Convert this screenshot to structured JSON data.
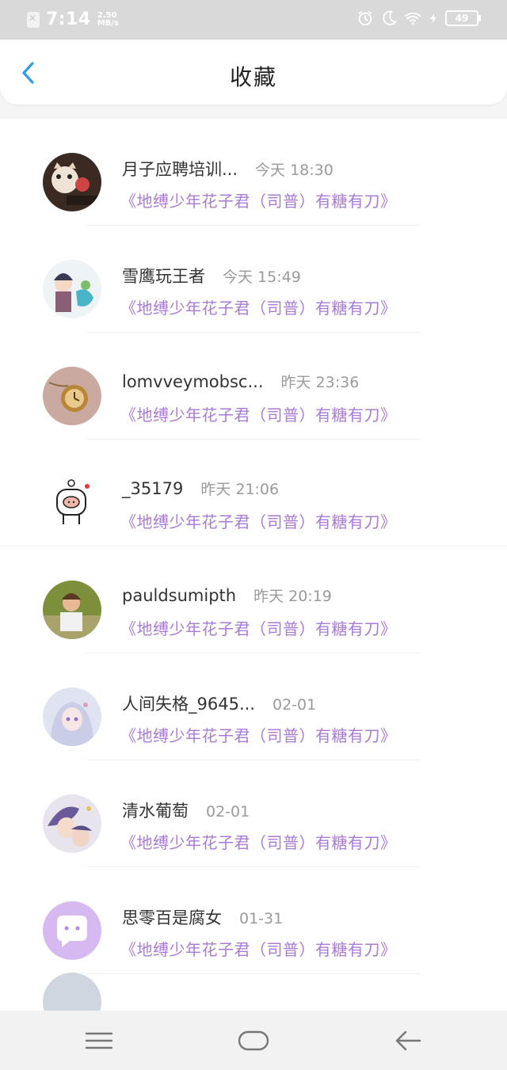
{
  "status_bar": {
    "time": "7:14",
    "speed_value": "2.50",
    "speed_unit": "MB/s",
    "battery": "49",
    "icons": [
      "notification-blocked-icon",
      "alarm-icon",
      "moon-icon",
      "wifi-icon",
      "charging-icon",
      "battery-icon"
    ]
  },
  "header": {
    "title": "收藏",
    "back_icon": "chevron-left-icon"
  },
  "items": [
    {
      "name": "月子应聘培训...",
      "time": "今天 18:30",
      "quote": "《地缚少年花子君（司普）有糖有刀》"
    },
    {
      "name": "雪鹰玩王者",
      "time": "今天 15:49",
      "quote": "《地缚少年花子君（司普）有糖有刀》"
    },
    {
      "name": "lomvveymobsc...",
      "time": "昨天 23:36",
      "quote": "《地缚少年花子君（司普）有糖有刀》"
    },
    {
      "name": "_35179",
      "time": "昨天 21:06",
      "quote": "《地缚少年花子君（司普）有糖有刀》"
    },
    {
      "name": "pauldsumipth",
      "time": "昨天 20:19",
      "quote": "《地缚少年花子君（司普）有糖有刀》"
    },
    {
      "name": "人间失格_9645...",
      "time": "02-01",
      "quote": "《地缚少年花子君（司普）有糖有刀》"
    },
    {
      "name": "清水葡萄",
      "time": "02-01",
      "quote": "《地缚少年花子君（司普）有糖有刀》"
    },
    {
      "name": "思零百是腐女",
      "time": "01-31",
      "quote": "《地缚少年花子君（司普）有糖有刀》"
    }
  ],
  "colors": {
    "accent_blue": "#2f9be8",
    "quote_purple": "#a97ad6",
    "status_bar_bg": "#d9d9d9"
  },
  "nav_bar": {
    "icons": [
      "menu-icon",
      "home-icon",
      "back-arrow-icon"
    ]
  }
}
